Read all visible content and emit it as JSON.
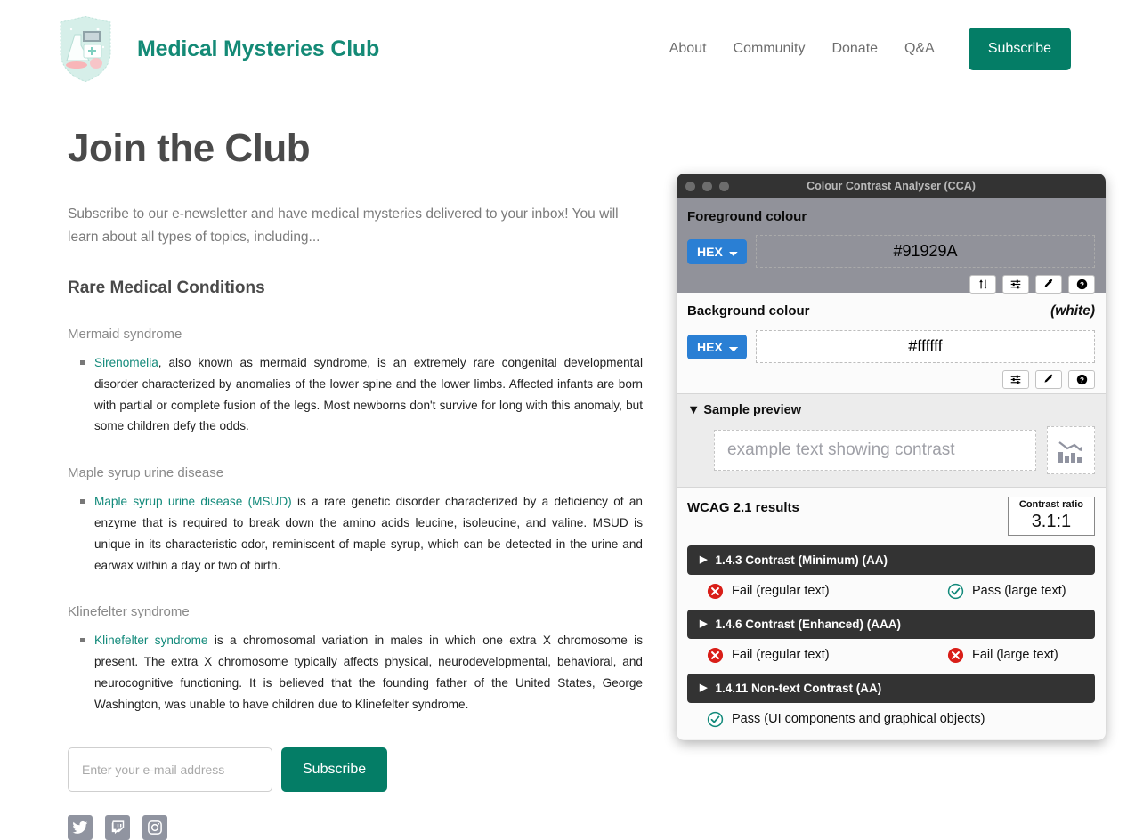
{
  "header": {
    "brand_title": "Medical Mysteries Club",
    "logo_icon": "shield-lab-logo",
    "nav": [
      {
        "label": "About"
      },
      {
        "label": "Community"
      },
      {
        "label": "Donate"
      },
      {
        "label": "Q&A"
      }
    ],
    "subscribe_label": "Subscribe",
    "brand_color": "#148a76",
    "button_color": "#047d66"
  },
  "main": {
    "page_title": "Join the Club",
    "intro": "Subscribe to our e-newsletter and have medical mysteries delivered to your inbox! You will learn about all types of topics, including...",
    "section_heading": "Rare Medical Conditions",
    "conditions": [
      {
        "heading": "Mermaid syndrome",
        "link_text": "Sirenomelia",
        "body": ", also known as mermaid syndrome, is an extremely rare congenital developmental disorder characterized by anomalies of the lower spine and the lower limbs. Affected infants are born with partial or complete fusion of the legs. Most newborns don't survive for long with this anomaly, but some children defy the odds."
      },
      {
        "heading": "Maple syrup urine disease",
        "link_text": "Maple syrup urine disease (MSUD)",
        "body": " is a rare genetic disorder characterized by a deficiency of an enzyme that is required to break down the amino acids leucine, isoleucine, and valine. MSUD is unique in its characteristic odor, reminiscent of maple syrup, which can be detected in the urine and earwax within a day or two of birth."
      },
      {
        "heading": "Klinefelter syndrome",
        "link_text": "Klinefelter syndrome",
        "body": " is a chromosomal variation in males in which one extra X chromosome is present. The extra X chromosome typically affects physical, neurodevelopmental, behavioral, and neurocognitive functioning. It is believed that the founding father of the United States, George Washington, was unable to have children due to Klinefelter syndrome."
      }
    ],
    "form": {
      "email_placeholder": "Enter your e-mail address",
      "email_value": "",
      "subscribe_label": "Subscribe"
    },
    "socials": [
      {
        "name": "twitter-icon"
      },
      {
        "name": "twitch-icon"
      },
      {
        "name": "instagram-icon"
      }
    ],
    "link_color": "#11897a"
  },
  "cca": {
    "window_title": "Colour Contrast Analyser (CCA)",
    "foreground": {
      "label": "Foreground colour",
      "format": "HEX",
      "value": "#91929A",
      "panel_color": "#91929A",
      "icons": [
        "swap-arrows-icon",
        "sliders-icon",
        "eyedropper-icon",
        "help-icon"
      ]
    },
    "background": {
      "label": "Background colour",
      "note": "(white)",
      "format": "HEX",
      "value": "#ffffff",
      "icons": [
        "sliders-icon",
        "eyedropper-icon",
        "help-icon"
      ]
    },
    "preview": {
      "label": "Sample preview",
      "sample_text": "example text showing contrast",
      "graphic_icon": "bar-chart-declining-icon",
      "expanded": true
    },
    "results": {
      "label": "WCAG 2.1 results",
      "ratio_caption": "Contrast ratio",
      "ratio_value": "3.1:1",
      "criteria": [
        {
          "title": "1.4.3 Contrast (Minimum) (AA)",
          "expanded": false,
          "results": [
            {
              "status": "fail",
              "text": "Fail (regular text)"
            },
            {
              "status": "pass",
              "text": "Pass (large text)"
            }
          ]
        },
        {
          "title": "1.4.6 Contrast (Enhanced) (AAA)",
          "expanded": false,
          "results": [
            {
              "status": "fail",
              "text": "Fail (regular text)"
            },
            {
              "status": "fail",
              "text": "Fail (large text)"
            }
          ]
        },
        {
          "title": "1.4.11 Non-text Contrast (AA)",
          "expanded": false,
          "results": [
            {
              "status": "pass",
              "text": "Pass (UI components and graphical objects)"
            }
          ]
        }
      ],
      "fail_color": "#d91e18",
      "pass_color": "#11897a"
    }
  }
}
